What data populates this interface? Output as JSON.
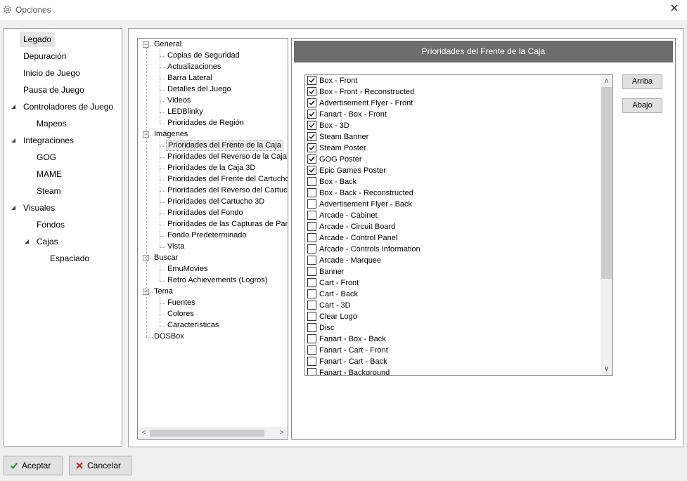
{
  "window": {
    "title": "Opciones",
    "close_glyph": "✕"
  },
  "left_nav": [
    {
      "label": "Legado",
      "level": 0,
      "selected": true,
      "expander": ""
    },
    {
      "label": "Depuración",
      "level": 0,
      "expander": ""
    },
    {
      "label": "Inicio de Juego",
      "level": 0,
      "expander": ""
    },
    {
      "label": "Pausa de Juego",
      "level": 0,
      "expander": ""
    },
    {
      "label": "Controladores de Juego",
      "level": 0,
      "expander": "◢"
    },
    {
      "label": "Mapeos",
      "level": 1,
      "expander": ""
    },
    {
      "label": "Integraciones",
      "level": 0,
      "expander": "◢"
    },
    {
      "label": "GOG",
      "level": 1,
      "expander": ""
    },
    {
      "label": "MAME",
      "level": 1,
      "expander": ""
    },
    {
      "label": "Steam",
      "level": 1,
      "expander": ""
    },
    {
      "label": "Visuales",
      "level": 0,
      "expander": "◢"
    },
    {
      "label": "Fondos",
      "level": 1,
      "expander": ""
    },
    {
      "label": "Cajas",
      "level": 1,
      "expander": "◢"
    },
    {
      "label": "Espaciado",
      "level": 2,
      "expander": ""
    }
  ],
  "tree": {
    "collapse_glyph": "−",
    "groups": [
      {
        "label": "General",
        "children": [
          "Copias de Seguridad",
          "Actualizaciones",
          "Barra Lateral",
          "Detalles del Juego",
          "Videos",
          "LEDBlinky",
          "Prioridades de Región"
        ]
      },
      {
        "label": "Imágenes",
        "children": [
          "Prioridades del Frente de la Caja",
          "Prioridades del Reverso de la Caja",
          "Prioridades de la Caja 3D",
          "Prioridades del Frente del Cartucho",
          "Prioridades del Reverso del Cartucho",
          "Prioridades del Cartucho 3D",
          "Prioridades del Fondo",
          "Prioridades de las Capturas de Pantalla",
          "Fondo Predeterminado",
          "Vista"
        ]
      },
      {
        "label": "Buscar",
        "children": [
          "EmuMovies",
          "Retro Achievements (Logros)"
        ]
      },
      {
        "label": "Tema",
        "children": [
          "Fuentes",
          "Colores",
          "Características"
        ]
      },
      {
        "label": "DOSBox",
        "children": []
      }
    ],
    "selected": "Prioridades del Frente de la Caja"
  },
  "panel": {
    "header": "Prioridades del Frente de la Caja",
    "up_label": "Arriba",
    "down_label": "Abajo",
    "items": [
      {
        "label": "Box - Front",
        "checked": true
      },
      {
        "label": "Box - Front - Reconstructed",
        "checked": true
      },
      {
        "label": "Advertisement Flyer - Front",
        "checked": true
      },
      {
        "label": "Fanart - Box - Front",
        "checked": true
      },
      {
        "label": "Box - 3D",
        "checked": true
      },
      {
        "label": "Steam Banner",
        "checked": true
      },
      {
        "label": "Steam Poster",
        "checked": true
      },
      {
        "label": "GOG Poster",
        "checked": true
      },
      {
        "label": "Epic Games Poster",
        "checked": true
      },
      {
        "label": "Box - Back",
        "checked": false
      },
      {
        "label": "Box - Back - Reconstructed",
        "checked": false
      },
      {
        "label": "Advertisement Flyer - Back",
        "checked": false
      },
      {
        "label": "Arcade - Cabinet",
        "checked": false
      },
      {
        "label": "Arcade - Circuit Board",
        "checked": false
      },
      {
        "label": "Arcade - Control Panel",
        "checked": false
      },
      {
        "label": "Arcade - Controls Information",
        "checked": false
      },
      {
        "label": "Arcade - Marquee",
        "checked": false
      },
      {
        "label": "Banner",
        "checked": false
      },
      {
        "label": "Cart - Front",
        "checked": false
      },
      {
        "label": "Cart - Back",
        "checked": false
      },
      {
        "label": "Cart - 3D",
        "checked": false
      },
      {
        "label": "Clear Logo",
        "checked": false
      },
      {
        "label": "Disc",
        "checked": false
      },
      {
        "label": "Fanart - Box - Back",
        "checked": false
      },
      {
        "label": "Fanart - Cart - Front",
        "checked": false
      },
      {
        "label": "Fanart - Cart - Back",
        "checked": false
      },
      {
        "label": "Fanart - Background",
        "checked": false
      }
    ]
  },
  "footer": {
    "accept_label": "Aceptar",
    "cancel_label": "Cancelar",
    "accept_icon": "check-icon",
    "cancel_icon": "x-icon",
    "accept_color": "#2e9e2e",
    "cancel_color": "#d12a2a"
  },
  "scroll_glyphs": {
    "left": "<",
    "right": ">",
    "up": "∧",
    "down": "∨"
  },
  "colors": {
    "header_bg": "#6d6d6d",
    "selected_bg": "#e5e5e5"
  }
}
